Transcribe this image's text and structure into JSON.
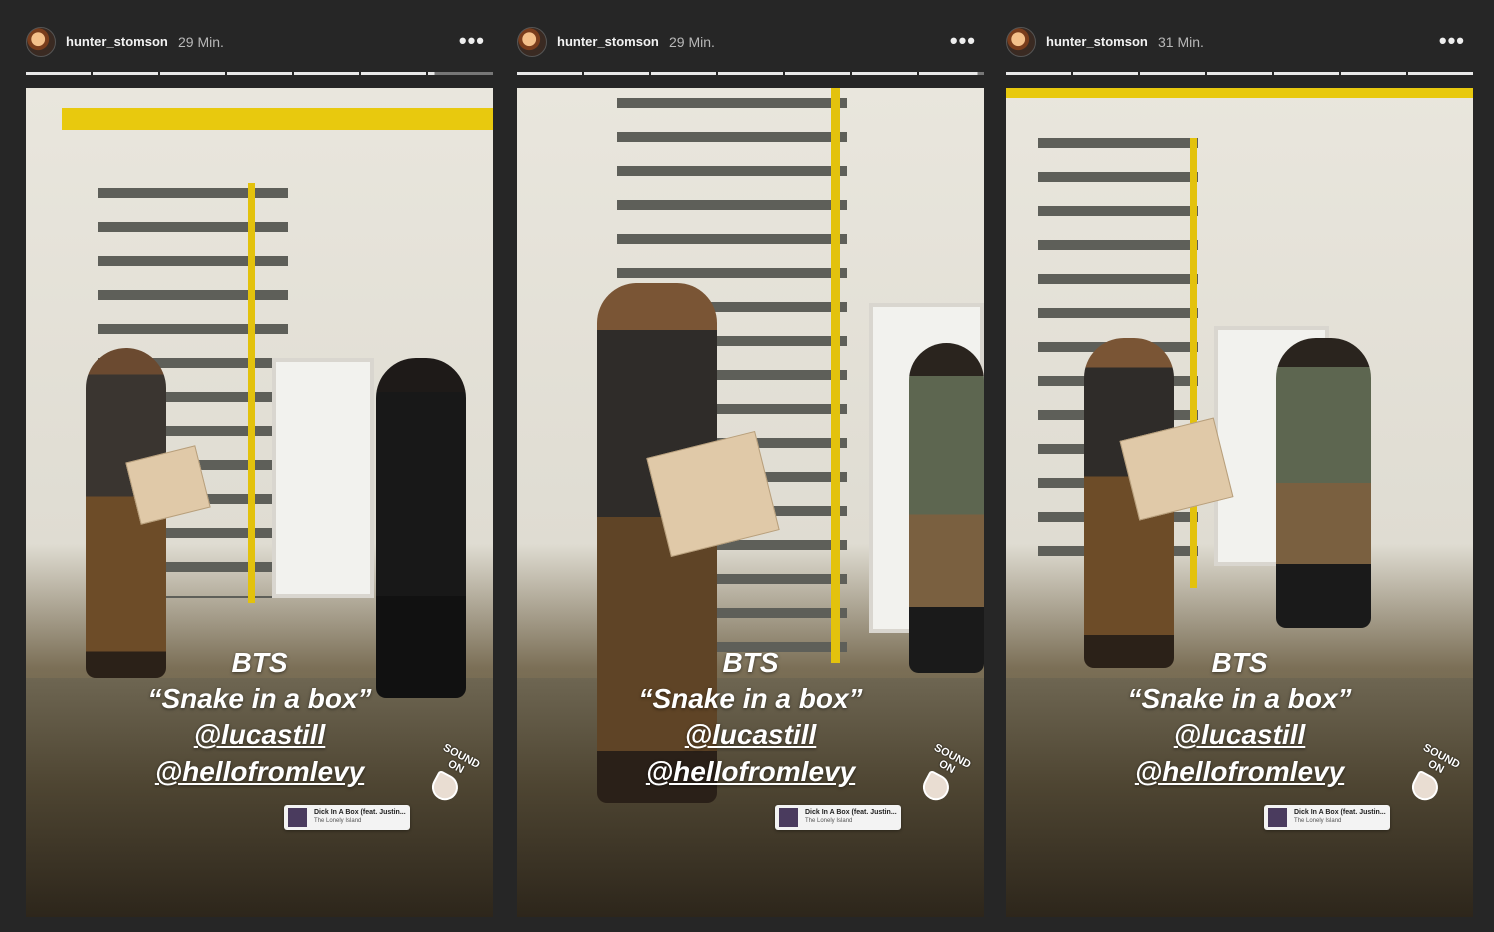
{
  "stories": [
    {
      "username": "hunter_stomson",
      "time": "29 Min.",
      "more_icon": "more-horizontal-icon",
      "progress_segments": [
        1,
        1,
        1,
        1,
        1,
        1,
        0.1
      ],
      "caption": {
        "line1": "BTS",
        "line2": "“Snake in a box”",
        "mention1": "@lucastill",
        "mention2": "@hellofromlevy"
      },
      "sound_sticker": "SOUND ON",
      "music": {
        "song": "Dick In A Box (feat. Justin...",
        "artist": "The Lonely Island"
      }
    },
    {
      "username": "hunter_stomson",
      "time": "29 Min.",
      "more_icon": "more-horizontal-icon",
      "progress_segments": [
        1,
        1,
        1,
        1,
        1,
        1,
        0.9
      ],
      "caption": {
        "line1": "BTS",
        "line2": "“Snake in a box”",
        "mention1": "@lucastill",
        "mention2": "@hellofromlevy"
      },
      "sound_sticker": "SOUND ON",
      "music": {
        "song": "Dick In A Box (feat. Justin...",
        "artist": "The Lonely Island"
      }
    },
    {
      "username": "hunter_stomson",
      "time": "31 Min.",
      "more_icon": "more-horizontal-icon",
      "progress_segments": [
        1,
        1,
        1,
        1,
        1,
        1,
        1
      ],
      "caption": {
        "line1": "BTS",
        "line2": "“Snake in a box”",
        "mention1": "@lucastill",
        "mention2": "@hellofromlevy"
      },
      "sound_sticker": "SOUND ON",
      "music": {
        "song": "Dick In A Box (feat. Justin...",
        "artist": "The Lonely Island"
      }
    }
  ],
  "colors": {
    "background": "#262626",
    "accent_yellow": "#e3c20d",
    "progress": "#e8e8e8"
  }
}
